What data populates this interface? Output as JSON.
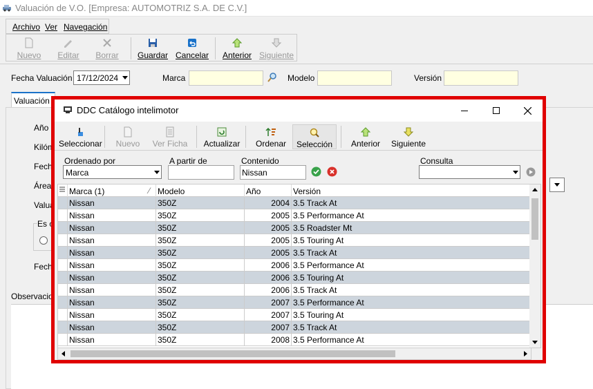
{
  "window": {
    "title": "Valuación de V.O. [Empresa: AUTOMOTRIZ S.A. DE C.V.]"
  },
  "menu": {
    "archivo": "Archivo",
    "ver": "Ver",
    "navegacion": "Navegación"
  },
  "toolbar": {
    "nuevo": "Nuevo",
    "editar": "Editar",
    "borrar": "Borrar",
    "guardar": "Guardar",
    "cancelar": "Cancelar",
    "anterior": "Anterior",
    "siguiente": "Siguiente"
  },
  "form": {
    "fecha_label": "Fecha Valuación",
    "fecha_value": "17/12/2024",
    "marca_label": "Marca",
    "modelo_label": "Modelo",
    "version_label": "Versión",
    "tab_label": "Valuación",
    "left_labels": [
      "Año M",
      "Kilóm",
      "Fech",
      "Área",
      "Valua"
    ],
    "group_label": "Es c",
    "fecha2_label": "Fech",
    "observ_label": "Observacione"
  },
  "dialog": {
    "title": "DDC Catálogo intelimotor",
    "toolbar": {
      "seleccionar": "Seleccionar",
      "nuevo": "Nuevo",
      "ver_ficha": "Ver Ficha",
      "actualizar": "Actualizar",
      "ordenar": "Ordenar",
      "seleccion": "Selección",
      "anterior": "Anterior",
      "siguiente": "Siguiente"
    },
    "filters": {
      "ordenado_por_label": "Ordenado por",
      "ordenado_por_value": "Marca",
      "a_partir_label": "A partir de",
      "a_partir_value": "",
      "contenido_label": "Contenido",
      "contenido_value": "Nissan",
      "consulta_label": "Consulta",
      "consulta_value": ""
    },
    "grid": {
      "headers": [
        "Marca (1)",
        "Modelo",
        "Año",
        "Versión"
      ],
      "rows": [
        [
          "Nissan",
          "350Z",
          "2004",
          "3.5 Track At"
        ],
        [
          "Nissan",
          "350Z",
          "2005",
          "3.5 Performance At"
        ],
        [
          "Nissan",
          "350Z",
          "2005",
          "3.5 Roadster Mt"
        ],
        [
          "Nissan",
          "350Z",
          "2005",
          "3.5 Touring At"
        ],
        [
          "Nissan",
          "350Z",
          "2005",
          "3.5 Track At"
        ],
        [
          "Nissan",
          "350Z",
          "2006",
          "3.5 Performance At"
        ],
        [
          "Nissan",
          "350Z",
          "2006",
          "3.5 Touring At"
        ],
        [
          "Nissan",
          "350Z",
          "2006",
          "3.5 Track At"
        ],
        [
          "Nissan",
          "350Z",
          "2007",
          "3.5 Performance At"
        ],
        [
          "Nissan",
          "350Z",
          "2007",
          "3.5 Touring At"
        ],
        [
          "Nissan",
          "350Z",
          "2007",
          "3.5 Track At"
        ],
        [
          "Nissan",
          "350Z",
          "2008",
          "3.5 Performance At"
        ]
      ]
    }
  },
  "colors": {
    "highlight": "#e00000",
    "row_alt": "#cdd5dd",
    "input_yellow": "#ffffe1"
  }
}
